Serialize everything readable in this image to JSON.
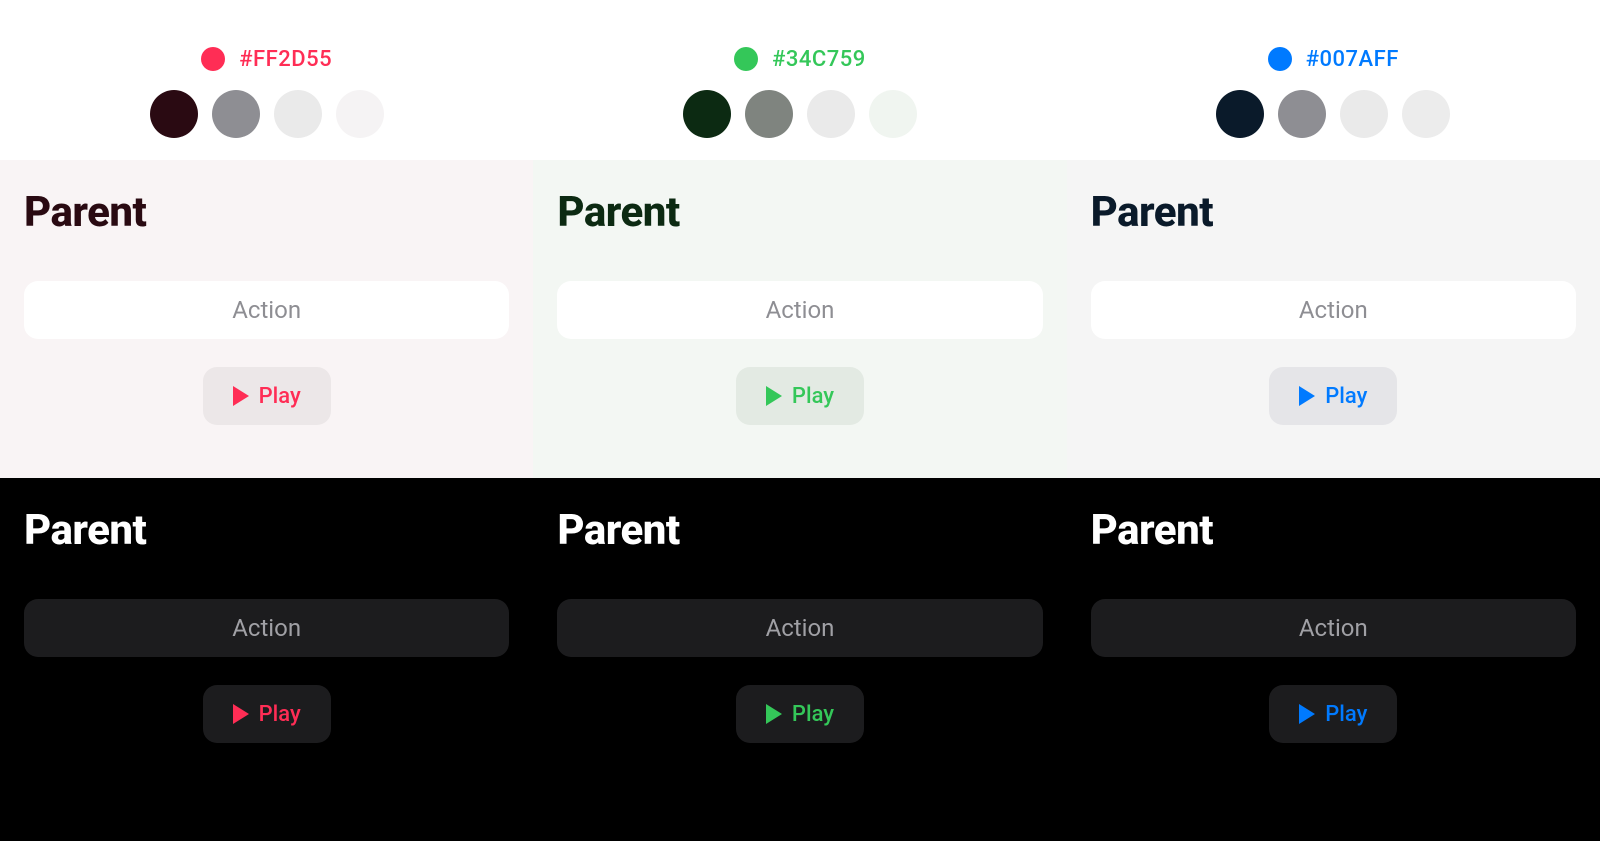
{
  "columns": [
    {
      "hex": "#FF2D55",
      "accent": "#FF2D55",
      "swatches": [
        "#2A0A12",
        "#8E8E93",
        "#EAEAEA",
        "#F5F3F4"
      ],
      "light": {
        "bg": "#F9F4F5",
        "title": "Parent",
        "title_color": "#2A0A12",
        "action_label": "Action",
        "play_label": "Play",
        "play_bg": "#ECE7E8",
        "play_color": "#FF2D55"
      },
      "dark": {
        "title": "Parent",
        "title_color": "#FFFFFF",
        "action_label": "Action",
        "play_label": "Play",
        "play_bg": "#1c1c1e",
        "play_color": "#FF2D55"
      }
    },
    {
      "hex": "#34C759",
      "accent": "#34C759",
      "swatches": [
        "#0C2A12",
        "#7F847F",
        "#EAEAEA",
        "#F0F5F0"
      ],
      "light": {
        "bg": "#F3F7F3",
        "title": "Parent",
        "title_color": "#0C2A12",
        "action_label": "Action",
        "play_label": "Play",
        "play_bg": "#E3EAE3",
        "play_color": "#34C759"
      },
      "dark": {
        "title": "Parent",
        "title_color": "#FFFFFF",
        "action_label": "Action",
        "play_label": "Play",
        "play_bg": "#1c1c1e",
        "play_color": "#34C759"
      }
    },
    {
      "hex": "#007AFF",
      "accent": "#007AFF",
      "swatches": [
        "#0A1A2A",
        "#8E8E93",
        "#EAEAEA",
        "#ECECEC"
      ],
      "light": {
        "bg": "#F5F5F5",
        "title": "Parent",
        "title_color": "#0A1A2A",
        "action_label": "Action",
        "play_label": "Play",
        "play_bg": "#E5E5E8",
        "play_color": "#007AFF"
      },
      "dark": {
        "title": "Parent",
        "title_color": "#FFFFFF",
        "action_label": "Action",
        "play_label": "Play",
        "play_bg": "#1c1c1e",
        "play_color": "#007AFF"
      }
    }
  ]
}
